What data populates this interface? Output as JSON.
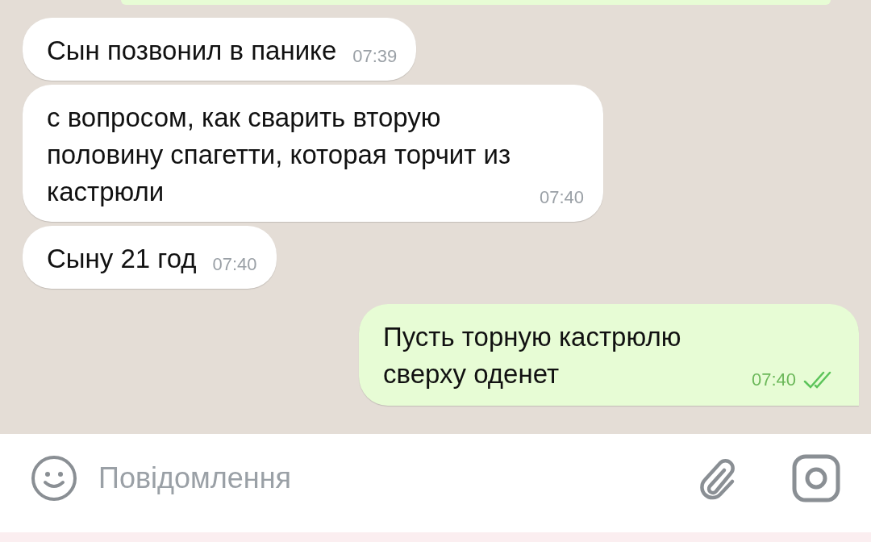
{
  "messages": [
    {
      "kind": "incoming",
      "text": "Сын позвонил в панике",
      "time": "07:39"
    },
    {
      "kind": "incoming",
      "text": "с вопросом, как сварить вторую половину спагетти, которая торчит из кастрюли",
      "time": "07:40"
    },
    {
      "kind": "incoming",
      "text": "Сыну 21 год",
      "time": "07:40"
    },
    {
      "kind": "outgoing",
      "text": "Пусть торную кастрюлю сверху оденет",
      "time": "07:40",
      "read": true
    }
  ],
  "composer": {
    "placeholder": "Повідомлення"
  }
}
